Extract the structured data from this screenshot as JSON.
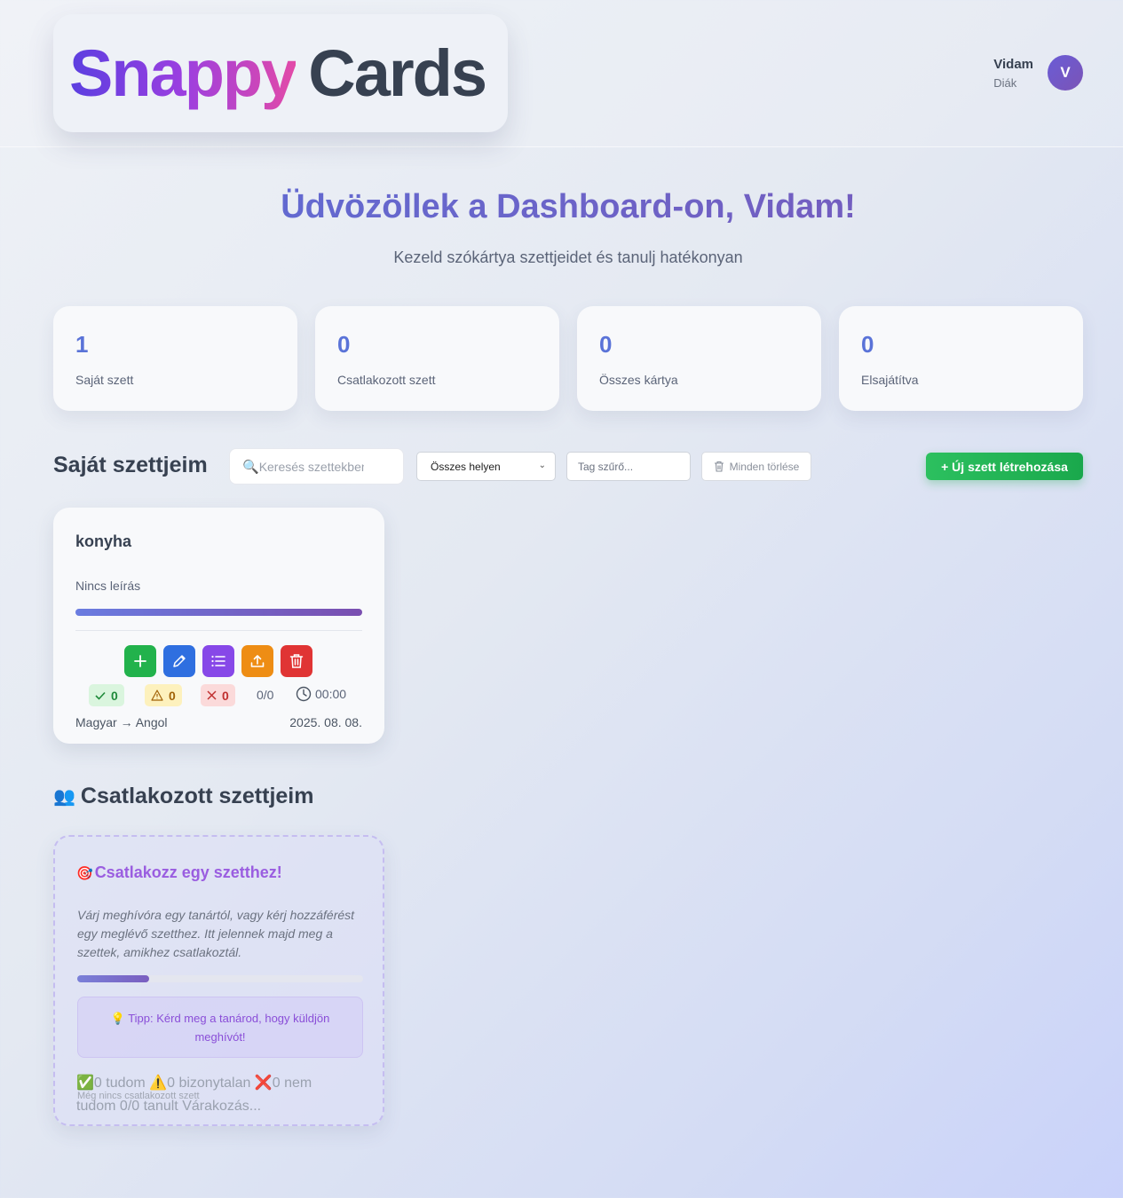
{
  "header": {
    "logo_part1": "Snappy",
    "logo_part2": "Cards",
    "user_name": "Vidam",
    "user_role": "Diák",
    "avatar_initial": "V"
  },
  "welcome": {
    "title": "Üdvözöllek a Dashboard-on, Vidam!",
    "subtitle": "Kezeld szókártya szettjeidet és tanulj hatékonyan"
  },
  "stats": [
    {
      "value": "1",
      "label": "Saját szett"
    },
    {
      "value": "0",
      "label": "Csatlakozott szett"
    },
    {
      "value": "0",
      "label": "Összes kártya"
    },
    {
      "value": "0",
      "label": "Elsajátítva"
    }
  ],
  "own_sets": {
    "title": "Saját szettjeim",
    "search_placeholder": "Keresés szettekben",
    "search_icon": "magnifier-icon",
    "location_filter_value": "Összes helyen",
    "tag_filter_placeholder": "Tag szűrő...",
    "clear_all_label": "Minden törlése",
    "new_set_label": "+ Új szett létrehozása",
    "cards": [
      {
        "title": "konyha",
        "description": "Nincs leírás",
        "progress": 1.0,
        "known": "0",
        "unsure": "0",
        "unknown": "0",
        "ratio": "0/0",
        "time": "00:00",
        "languages": "Magyar → Angol",
        "date": "2025. 08. 08."
      }
    ],
    "colors": {
      "green": "#22b24c",
      "blue": "#2f6fe0",
      "purple": "#8748e8",
      "orange": "#ee8d14",
      "red": "#e03434"
    }
  },
  "joined_sets": {
    "title": "Csatlakozott szettjeim",
    "title_emoji": "👥",
    "card_title": "Csatlakozz egy szetthez!",
    "card_title_emoji": "🎯",
    "card_text": "Várj meghívóra egy tanártól, vagy kérj hozzáférést egy meglévő szetthez. Itt jelennek majd meg a szettek, amikhez csatlakoztál.",
    "progress": 0.25,
    "tip": "💡 Tipp: Kérd meg a tanárod, hogy küldjön meghívót!",
    "stats_line": "✅0 tudom ⚠️0 bizonytalan ❌0 nem tudom 0/0 tanult Várakozás...",
    "empty_text": "Még nincs csatlakozott szett"
  }
}
